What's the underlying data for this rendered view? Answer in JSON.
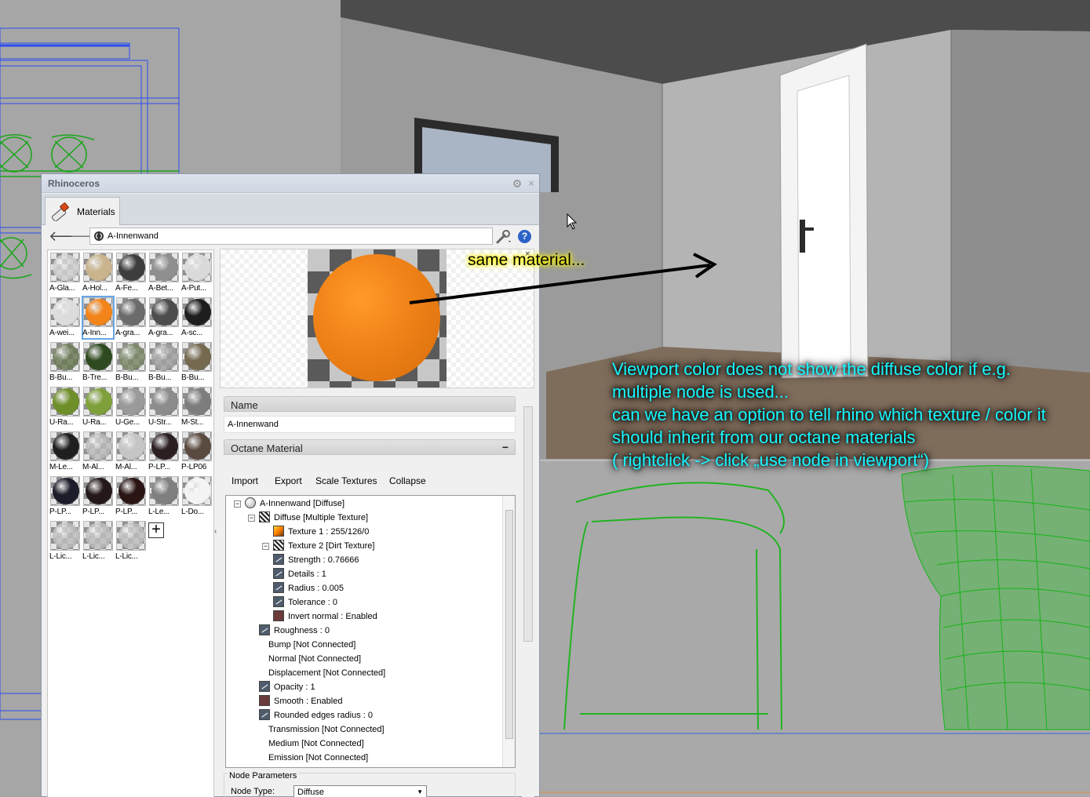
{
  "panel": {
    "title": "Rhinoceros",
    "tab_label": "Materials",
    "breadcrumb": "A-Innenwand"
  },
  "materials": [
    {
      "label": "A-Gla...",
      "color": "#cfcfcf",
      "checker": true
    },
    {
      "label": "A-Hol...",
      "color": "#c9b48e"
    },
    {
      "label": "A-Fe...",
      "color": "#3d3d3d"
    },
    {
      "label": "A-Bet...",
      "color": "#8f8f8f"
    },
    {
      "label": "A-Put...",
      "color": "#dadada"
    },
    {
      "label": "A-wei...",
      "color": "#dcdcdc"
    },
    {
      "label": "A-Inn...",
      "color": "#f28419",
      "selected": true
    },
    {
      "label": "A-gra...",
      "color": "#6b6b6b"
    },
    {
      "label": "A-gra...",
      "color": "#4d4d4d"
    },
    {
      "label": "A-sc...",
      "color": "#1e1e1e"
    },
    {
      "label": "B-Bu...",
      "color": "#6b7a55",
      "checker": true
    },
    {
      "label": "B-Tre...",
      "color": "#2f4a1f"
    },
    {
      "label": "B-Bu...",
      "color": "#7a8766",
      "checker": true
    },
    {
      "label": "B-Bu...",
      "color": "#a0a0a0",
      "checker": true
    },
    {
      "label": "B-Bu...",
      "color": "#756a50"
    },
    {
      "label": "U-Ra...",
      "color": "#6f8f2a"
    },
    {
      "label": "U-Ra...",
      "color": "#7ea03a"
    },
    {
      "label": "U-Ge...",
      "color": "#9a9a9a"
    },
    {
      "label": "U-Str...",
      "color": "#8c8c8c"
    },
    {
      "label": "M-St...",
      "color": "#7d7d7d"
    },
    {
      "label": "M-Le...",
      "color": "#1f1f1f"
    },
    {
      "label": "M-Al...",
      "color": "#b9b9b9",
      "checker": true
    },
    {
      "label": "M-Al...",
      "color": "#c5c5c5"
    },
    {
      "label": "P-LP...",
      "color": "#2b1f22"
    },
    {
      "label": "P-LP06",
      "color": "#5b4a40"
    },
    {
      "label": "P-LP...",
      "color": "#1c1c2a"
    },
    {
      "label": "P-LP...",
      "color": "#241818"
    },
    {
      "label": "P-LP...",
      "color": "#2a1414"
    },
    {
      "label": "L-Le...",
      "color": "#7f7f7f"
    },
    {
      "label": "L-Do...",
      "color": "#f4f4f4"
    },
    {
      "label": "L-Lic...",
      "color": "#bdbdbd",
      "checker": true
    },
    {
      "label": "L-Lic...",
      "color": "#bdbdbd",
      "checker": true
    },
    {
      "label": "L-Lic...",
      "color": "#bdbdbd",
      "checker": true
    }
  ],
  "properties": {
    "name_header": "Name",
    "name_value": "A-Innenwand",
    "octane_header": "Octane Material",
    "octane_collapse": "−",
    "toolbar": [
      "Import",
      "Export",
      "Scale Textures",
      "Collapse"
    ]
  },
  "node_tree": [
    {
      "text": "A-Innenwand  [Diffuse]",
      "indent": 0,
      "icon": "sphere",
      "expander": "−"
    },
    {
      "text": "Diffuse  [Multiple Texture]",
      "indent": 1,
      "icon": "tex",
      "expander": "−"
    },
    {
      "text": "Texture 1 : 255/126/0",
      "indent": 2,
      "icon": "rgb"
    },
    {
      "text": "Texture 2  [Dirt Texture]",
      "indent": 2,
      "icon": "tex",
      "expander": "−"
    },
    {
      "text": "Strength : 0.76666",
      "indent": 3,
      "icon": "val"
    },
    {
      "text": "Details : 1",
      "indent": 3,
      "icon": "val"
    },
    {
      "text": "Radius : 0.005",
      "indent": 3,
      "icon": "val"
    },
    {
      "text": "Tolerance : 0",
      "indent": 3,
      "icon": "val"
    },
    {
      "text": "Invert normal : Enabled",
      "indent": 3,
      "icon": "bool"
    },
    {
      "text": "Roughness : 0",
      "indent": 1,
      "icon": "val"
    },
    {
      "text": "Bump  [Not Connected]",
      "indent": 1,
      "icon": "none"
    },
    {
      "text": "Normal  [Not Connected]",
      "indent": 1,
      "icon": "none"
    },
    {
      "text": "Displacement  [Not Connected]",
      "indent": 1,
      "icon": "none"
    },
    {
      "text": "Opacity : 1",
      "indent": 1,
      "icon": "val"
    },
    {
      "text": "Smooth : Enabled",
      "indent": 1,
      "icon": "bool"
    },
    {
      "text": "Rounded edges radius : 0",
      "indent": 1,
      "icon": "val"
    },
    {
      "text": "Transmission  [Not Connected]",
      "indent": 1,
      "icon": "none"
    },
    {
      "text": "Medium  [Not Connected]",
      "indent": 1,
      "icon": "none"
    },
    {
      "text": "Emission  [Not Connected]",
      "indent": 1,
      "icon": "none"
    }
  ],
  "node_params": {
    "title": "Node Parameters",
    "type_label": "Node Type:",
    "type_value": "Diffuse"
  },
  "annotations": {
    "same_material": "same material...",
    "note_lines": [
      "Viewport color does not show the diffuse color if e.g.",
      "multiple node is used...",
      "can we have an option to tell rhino which texture / color it",
      "should inherit from our octane materials",
      "( rightclick -> click „use node in viewport“)"
    ]
  },
  "icons": {
    "back": "arrow-left-icon",
    "forward": "arrow-right-icon",
    "tools": "wrench-icon",
    "help": "help-icon",
    "gear": "gear-icon",
    "close": "close-icon"
  },
  "glyphs": {
    "back": "🡐",
    "forward": "🡒",
    "gear": "⚙",
    "close": "×",
    "help": "?",
    "add": "+",
    "preview_close": "×",
    "select_arrow": "▼",
    "collapse_arrow": "‹"
  }
}
